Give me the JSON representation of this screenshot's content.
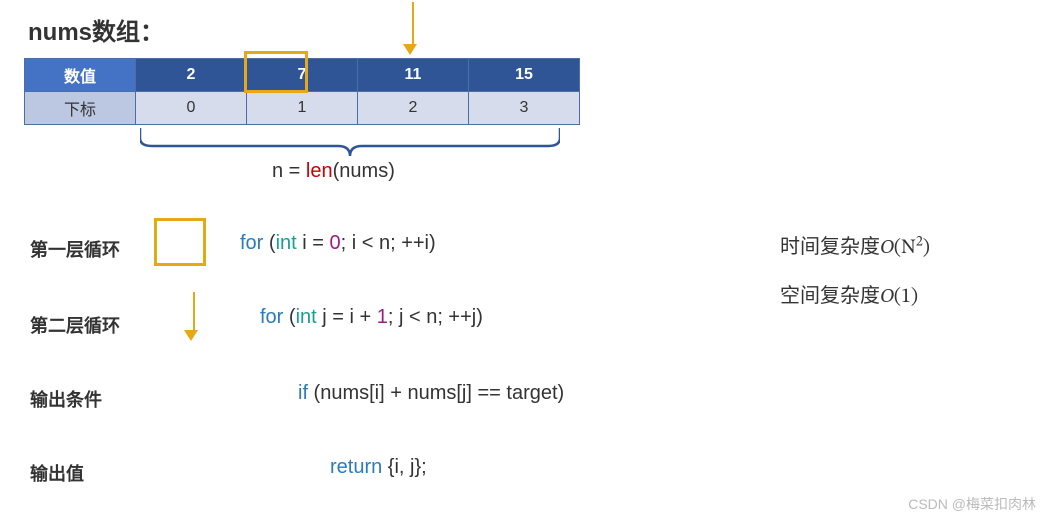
{
  "title": "nums数组：",
  "table": {
    "rowValuesHeader": "数值",
    "rowIndexHeader": "下标",
    "values": [
      "2",
      "7",
      "11",
      "15"
    ],
    "indices": [
      "0",
      "1",
      "2",
      "3"
    ]
  },
  "highlightIndex": 1,
  "lenExpr": {
    "lhs": "n = ",
    "fn": "len",
    "args": "(nums)"
  },
  "labels": {
    "loop1": "第一层循环",
    "loop2": "第二层循环",
    "cond": "输出条件",
    "out": "输出值"
  },
  "code": {
    "loop1": {
      "kw": "for",
      "open": " (",
      "typ": "int",
      "mid1": " i = ",
      "num": "0",
      "mid2": "; i < n; ++i)"
    },
    "loop2": {
      "kw": "for",
      "open": " (",
      "typ": "int",
      "mid1": " j = i + ",
      "num": "1",
      "mid2": "; j < n; ++j)"
    },
    "cond": {
      "kw": "if",
      "body": " (nums[i] + nums[j] == target)"
    },
    "ret": {
      "kw": "return",
      "body": " {i, j};"
    }
  },
  "complexity": {
    "time": {
      "label": "时间复杂度",
      "big": "O",
      "of": "(N",
      "sup": "2",
      "close": ")"
    },
    "space": {
      "label": "空间复杂度",
      "big": "O",
      "of": "(1)",
      "sup": "",
      "close": ""
    }
  },
  "watermark": "CSDN @梅菜扣肉林"
}
